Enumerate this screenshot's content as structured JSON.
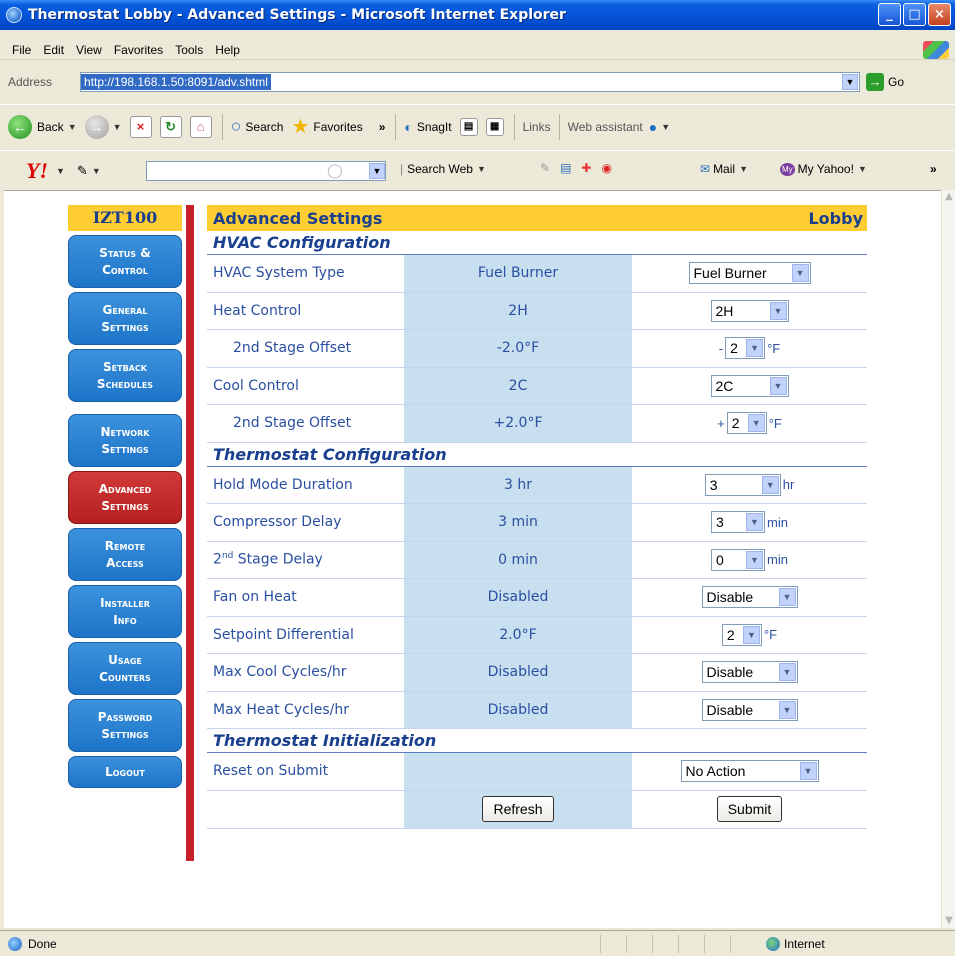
{
  "window": {
    "title": "Thermostat Lobby - Advanced Settings - Microsoft Internet Explorer"
  },
  "menu": [
    "File",
    "Edit",
    "View",
    "Favorites",
    "Tools",
    "Help"
  ],
  "address": {
    "label": "Address",
    "url": "http://198.168.1.50:8091/adv.shtml",
    "go_label": "Go"
  },
  "toolbar": {
    "back": "Back",
    "search": "Search",
    "favorites": "Favorites",
    "snagit": "SnagIt",
    "links": "Links",
    "web_assistant": "Web assistant"
  },
  "yahoo": {
    "logo": "Y!",
    "search_web": "Search Web",
    "mail": "Mail",
    "my_yahoo": "My Yahoo!"
  },
  "sidebar": {
    "title": "IZT100",
    "items": [
      {
        "line1": "Status &",
        "line2": "Control"
      },
      {
        "line1": "General",
        "line2": "Settings"
      },
      {
        "line1": "Setback",
        "line2": "Schedules"
      },
      {
        "line1": "Network",
        "line2": "Settings"
      },
      {
        "line1": "Advanced",
        "line2": "Settings"
      },
      {
        "line1": "Remote",
        "line2": "Access"
      },
      {
        "line1": "Installer",
        "line2": "Info"
      },
      {
        "line1": "Usage",
        "line2": "Counters"
      },
      {
        "line1": "Password",
        "line2": "Settings"
      },
      {
        "line1": "Logout",
        "line2": ""
      }
    ]
  },
  "main": {
    "header_title": "Advanced Settings",
    "header_location": "Lobby",
    "sections": {
      "hvac": "HVAC Configuration",
      "thermostat": "Thermostat Configuration",
      "init": "Thermostat Initialization"
    },
    "rows": {
      "hvac_type": {
        "label": "HVAC System Type",
        "current": "Fuel Burner",
        "select": "Fuel Burner"
      },
      "heat_control": {
        "label": "Heat Control",
        "current": "2H",
        "select": "2H"
      },
      "heat_offset": {
        "label": "2nd Stage Offset",
        "current": "-2.0°F",
        "prefix": "-",
        "select": "2",
        "unit": "°F"
      },
      "cool_control": {
        "label": "Cool Control",
        "current": "2C",
        "select": "2C"
      },
      "cool_offset": {
        "label": "2nd Stage Offset",
        "current": "+2.0°F",
        "prefix": "+",
        "select": "2",
        "unit": "°F"
      },
      "hold_mode": {
        "label": "Hold Mode Duration",
        "current": "3 hr",
        "select": "3",
        "unit": "hr"
      },
      "compressor_delay": {
        "label": "Compressor Delay",
        "current": "3 min",
        "select": "3",
        "unit": "min"
      },
      "stage_delay": {
        "label_pre": "2",
        "label_sup": "nd",
        "label_post": " Stage Delay",
        "current": "0 min",
        "select": "0",
        "unit": "min"
      },
      "fan_on_heat": {
        "label": "Fan on Heat",
        "current": "Disabled",
        "select": "Disable"
      },
      "setpoint_diff": {
        "label": "Setpoint Differential",
        "current": "2.0°F",
        "select": "2",
        "unit": "°F"
      },
      "max_cool": {
        "label": "Max Cool Cycles/hr",
        "current": "Disabled",
        "select": "Disable"
      },
      "max_heat": {
        "label": "Max Heat Cycles/hr",
        "current": "Disabled",
        "select": "Disable"
      },
      "reset": {
        "label": "Reset on Submit",
        "current": "",
        "select": "No Action"
      }
    },
    "buttons": {
      "refresh": "Refresh",
      "submit": "Submit"
    }
  },
  "status": {
    "text": "Done",
    "zone": "Internet"
  }
}
